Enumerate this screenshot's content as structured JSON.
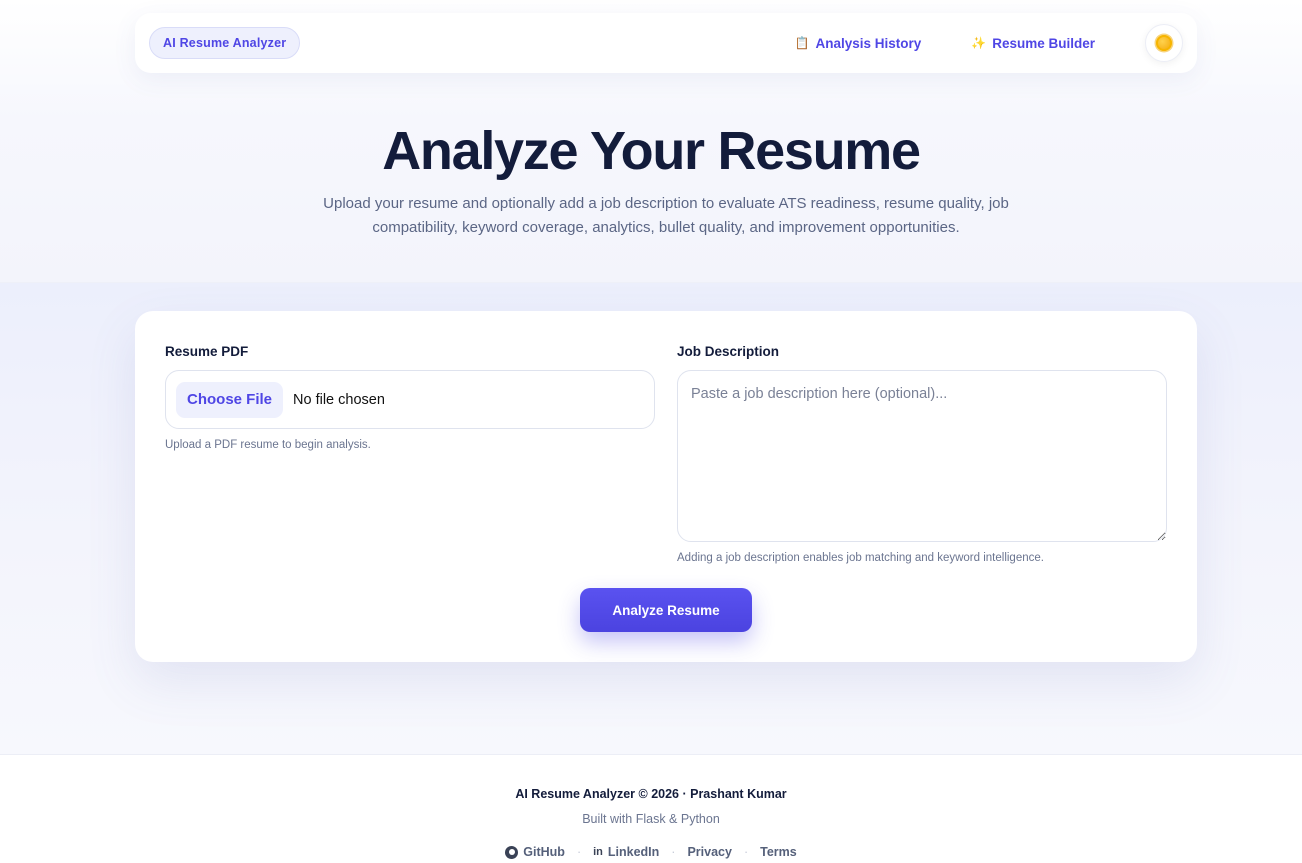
{
  "nav": {
    "brand": "AI Resume Analyzer",
    "links": [
      {
        "icon": "📋",
        "icon_name": "clipboard-icon",
        "label": "Analysis History"
      },
      {
        "icon": "✨",
        "icon_name": "sparkles-icon",
        "label": "Resume Builder"
      }
    ],
    "theme_icon": "sun-icon"
  },
  "hero": {
    "title": "Analyze Your Resume",
    "subtitle": "Upload your resume and optionally add a job description to evaluate ATS readiness, resume quality, job compatibility, keyword coverage, analytics, bullet quality, and improvement opportunities."
  },
  "form": {
    "resume_label": "Resume PDF",
    "choose_file_label": "Choose File",
    "file_status": "No file chosen",
    "resume_help": "Upload a PDF resume to begin analysis.",
    "jd_label": "Job Description",
    "jd_placeholder": "Paste a job description here (optional)...",
    "jd_value": "",
    "jd_help": "Adding a job description enables job matching and keyword intelligence.",
    "submit_label": "Analyze Resume"
  },
  "footer": {
    "main": "AI Resume Analyzer © 2026 · Prashant Kumar",
    "sub": "Built with Flask & Python",
    "links": {
      "github": "GitHub",
      "linkedin_icon": "in",
      "linkedin": "LinkedIn",
      "privacy": "Privacy",
      "terms": "Terms"
    },
    "separator": "·"
  },
  "colors": {
    "accent": "#4f46e5",
    "heading": "#131c3b",
    "muted": "#6b7590"
  }
}
